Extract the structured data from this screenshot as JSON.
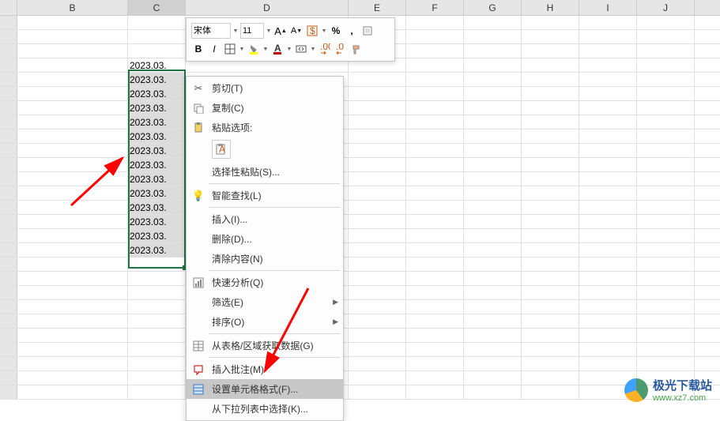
{
  "columns": [
    "B",
    "C",
    "D",
    "E",
    "F",
    "G",
    "H",
    "I",
    "J"
  ],
  "cells": {
    "c_values": [
      "2023.03.",
      "2023.03.",
      "2023.03.",
      "2023.03.",
      "2023.03.",
      "2023.03.",
      "2023.03.",
      "2023.03.",
      "2023.03.",
      "2023.03.",
      "2023.03.",
      "2023.03.",
      "2023.03.",
      "2023.03."
    ]
  },
  "mini": {
    "font": "宋体",
    "size": "11",
    "increaseFont": "A",
    "decreaseFont": "A",
    "percent": "%",
    "comma": ",",
    "bold": "B",
    "italic": "I"
  },
  "ctx": {
    "cut": "剪切(T)",
    "copy": "复制(C)",
    "pasteOptions": "粘贴选项:",
    "pasteSpecial": "选择性粘贴(S)...",
    "smartLookup": "智能查找(L)",
    "insert": "插入(I)...",
    "delete": "删除(D)...",
    "clear": "清除内容(N)",
    "quickAnalysis": "快速分析(Q)",
    "filter": "筛选(E)",
    "sort": "排序(O)",
    "getData": "从表格/区域获取数据(G)",
    "insertComment": "插入批注(M)",
    "formatCells": "设置单元格格式(F)...",
    "pickFromList": "从下拉列表中选择(K)..."
  },
  "watermark": {
    "cn": "极光下载站",
    "url": "www.xz7.com"
  }
}
